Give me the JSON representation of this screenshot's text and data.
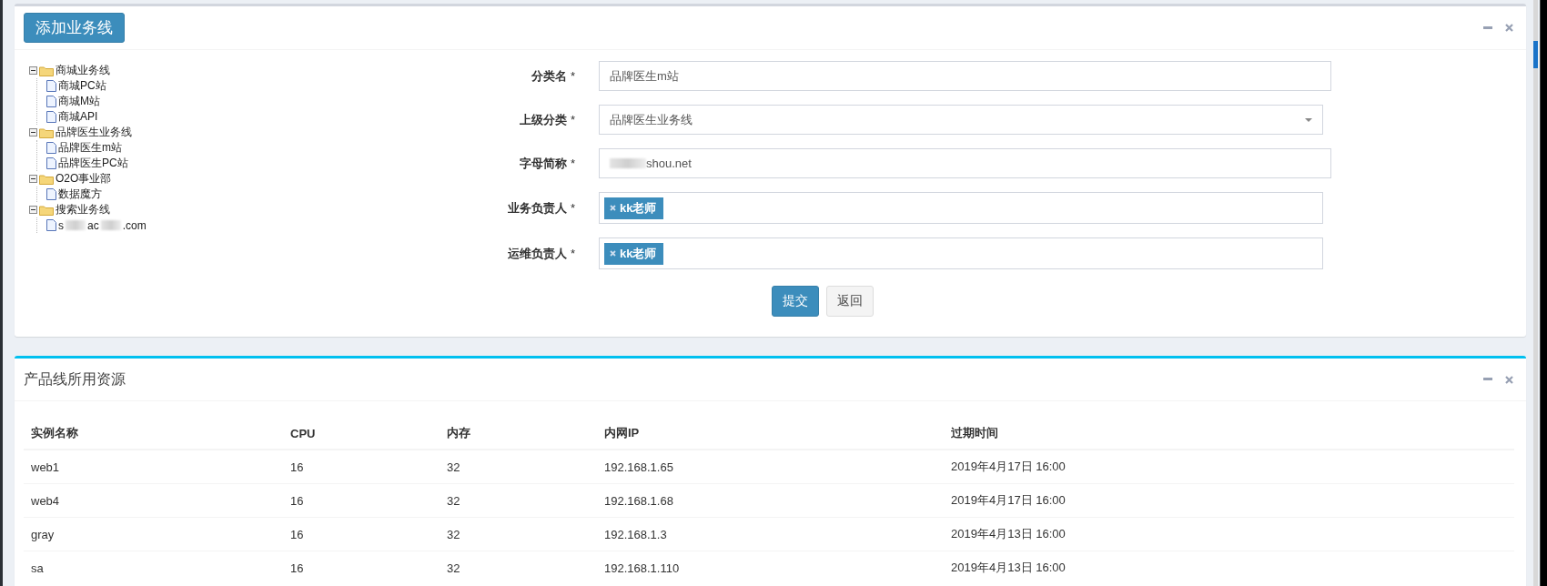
{
  "top_panel": {
    "add_button": "添加业务线",
    "tree": [
      {
        "label": "商城业务线",
        "expanded": true,
        "children": [
          {
            "label": "商城PC站"
          },
          {
            "label": "商城M站"
          },
          {
            "label": "商城API"
          }
        ]
      },
      {
        "label": "品牌医生业务线",
        "expanded": true,
        "children": [
          {
            "label": "品牌医生m站"
          },
          {
            "label": "品牌医生PC站"
          }
        ]
      },
      {
        "label": "O2O事业部",
        "expanded": true,
        "children": [
          {
            "label": "数据魔方"
          }
        ]
      },
      {
        "label": "搜索业务线",
        "expanded": true,
        "children": [
          {
            "label_parts": [
              "s",
              "ac",
              ".com"
            ]
          }
        ]
      }
    ],
    "form": [
      {
        "kind": "text",
        "label": "分类名",
        "required": "*",
        "value": "品牌医生m站"
      },
      {
        "kind": "select",
        "label": "上级分类",
        "required": "*",
        "value": "品牌医生业务线"
      },
      {
        "kind": "redacted",
        "label": "字母简称",
        "required": "*",
        "value": "shou.net"
      },
      {
        "kind": "tags",
        "label": "业务负责人",
        "required": "*",
        "tags": [
          "kk老师"
        ]
      },
      {
        "kind": "tags",
        "label": "运维负责人",
        "required": "*",
        "tags": [
          "kk老师"
        ]
      }
    ],
    "buttons": [
      {
        "label": "提交",
        "primary": true
      },
      {
        "label": "返回",
        "primary": false
      }
    ]
  },
  "resources_panel": {
    "title": "产品线所用资源",
    "columns": [
      "实例名称",
      "CPU",
      "内存",
      "内网IP",
      "过期时间"
    ],
    "rows": [
      [
        "web1",
        "16",
        "32",
        "192.168.1.65",
        "2019年4月17日 16:00"
      ],
      [
        "web4",
        "16",
        "32",
        "192.168.1.68",
        "2019年4月17日 16:00"
      ],
      [
        "gray",
        "16",
        "32",
        "192.168.1.3",
        "2019年4月13日 16:00"
      ],
      [
        "sa",
        "16",
        "32",
        "192.168.1.110",
        "2019年4月13日 16:00"
      ]
    ]
  }
}
